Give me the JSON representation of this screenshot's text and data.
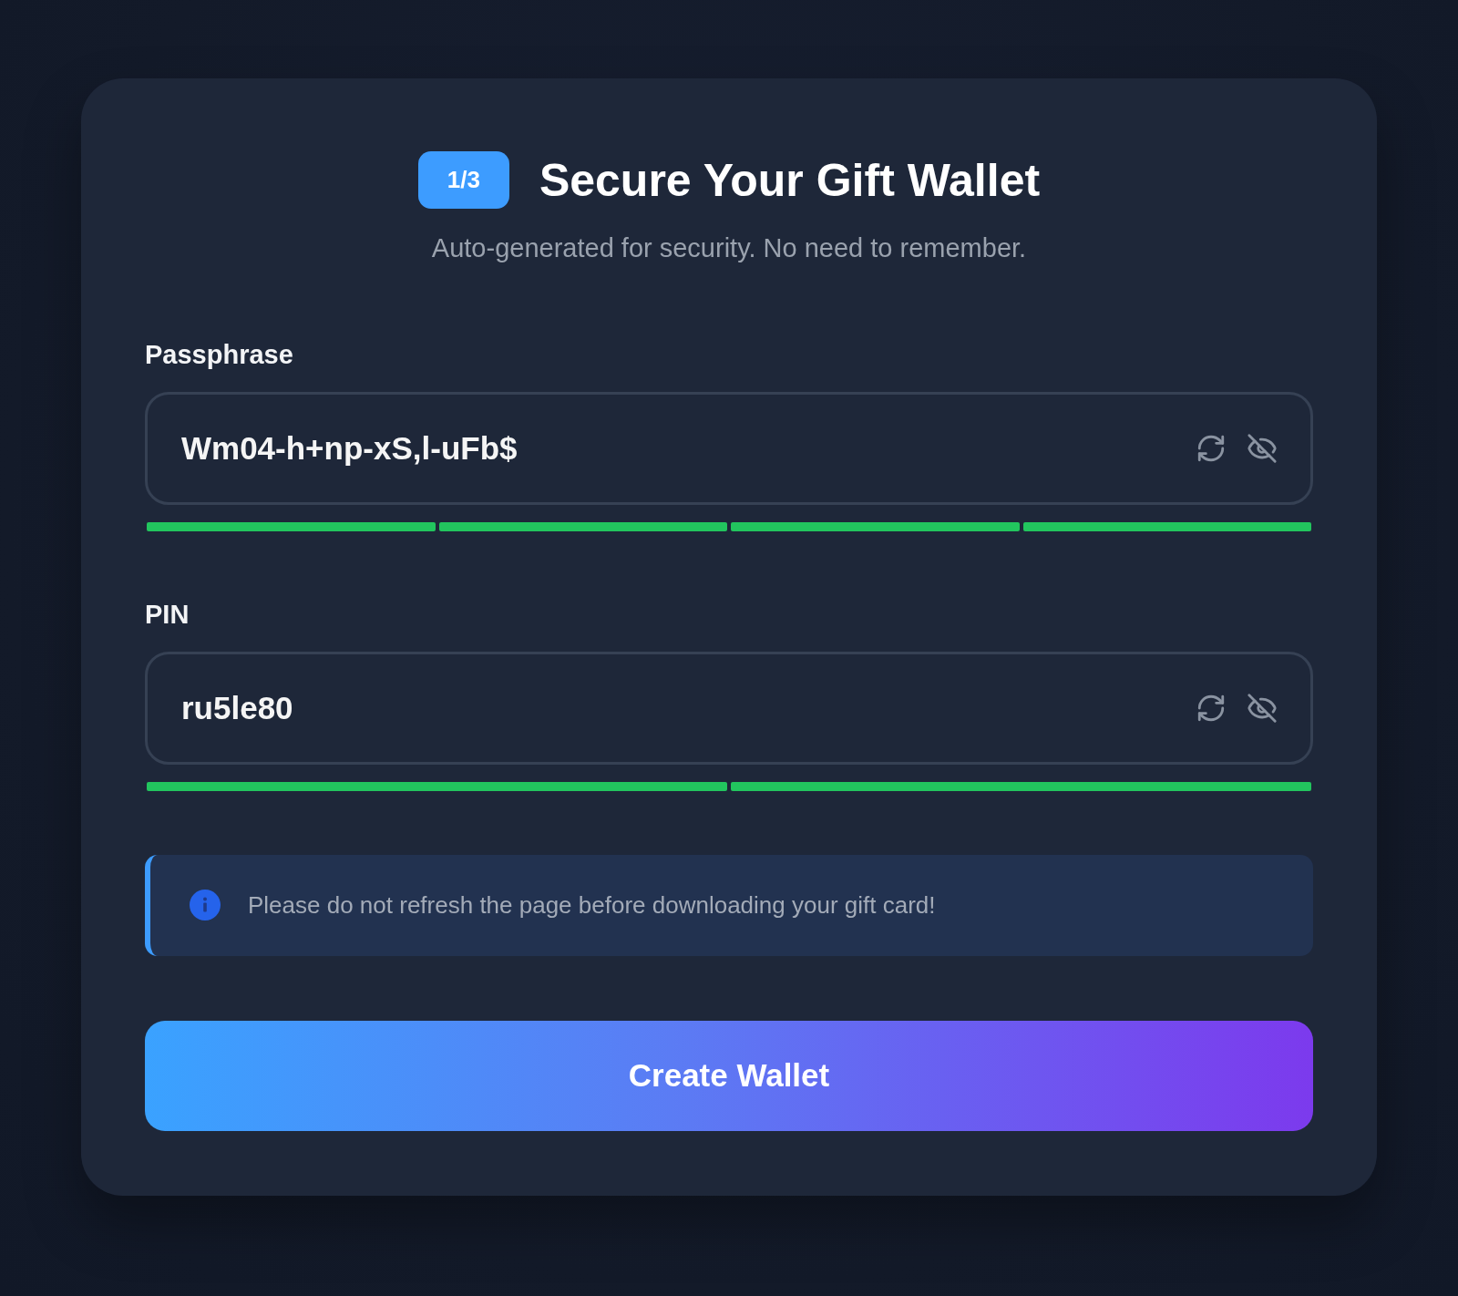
{
  "header": {
    "step_badge": "1/3",
    "title": "Secure Your Gift Wallet",
    "subtitle": "Auto-generated for security. No need to remember."
  },
  "fields": [
    {
      "label": "Passphrase",
      "value": "Wm04-h+np-xS,l-uFb$",
      "strength_segments": [
        {
          "filled": true
        },
        {
          "filled": true
        },
        {
          "filled": true
        },
        {
          "filled": true
        }
      ]
    },
    {
      "label": "PIN",
      "value": "ru5le80",
      "strength_segments": [
        {
          "filled": true
        },
        {
          "filled": true
        }
      ]
    }
  ],
  "notice": {
    "text": "Please do not refresh the page before downloading your gift card!"
  },
  "primary_button": {
    "label": "Create Wallet"
  }
}
